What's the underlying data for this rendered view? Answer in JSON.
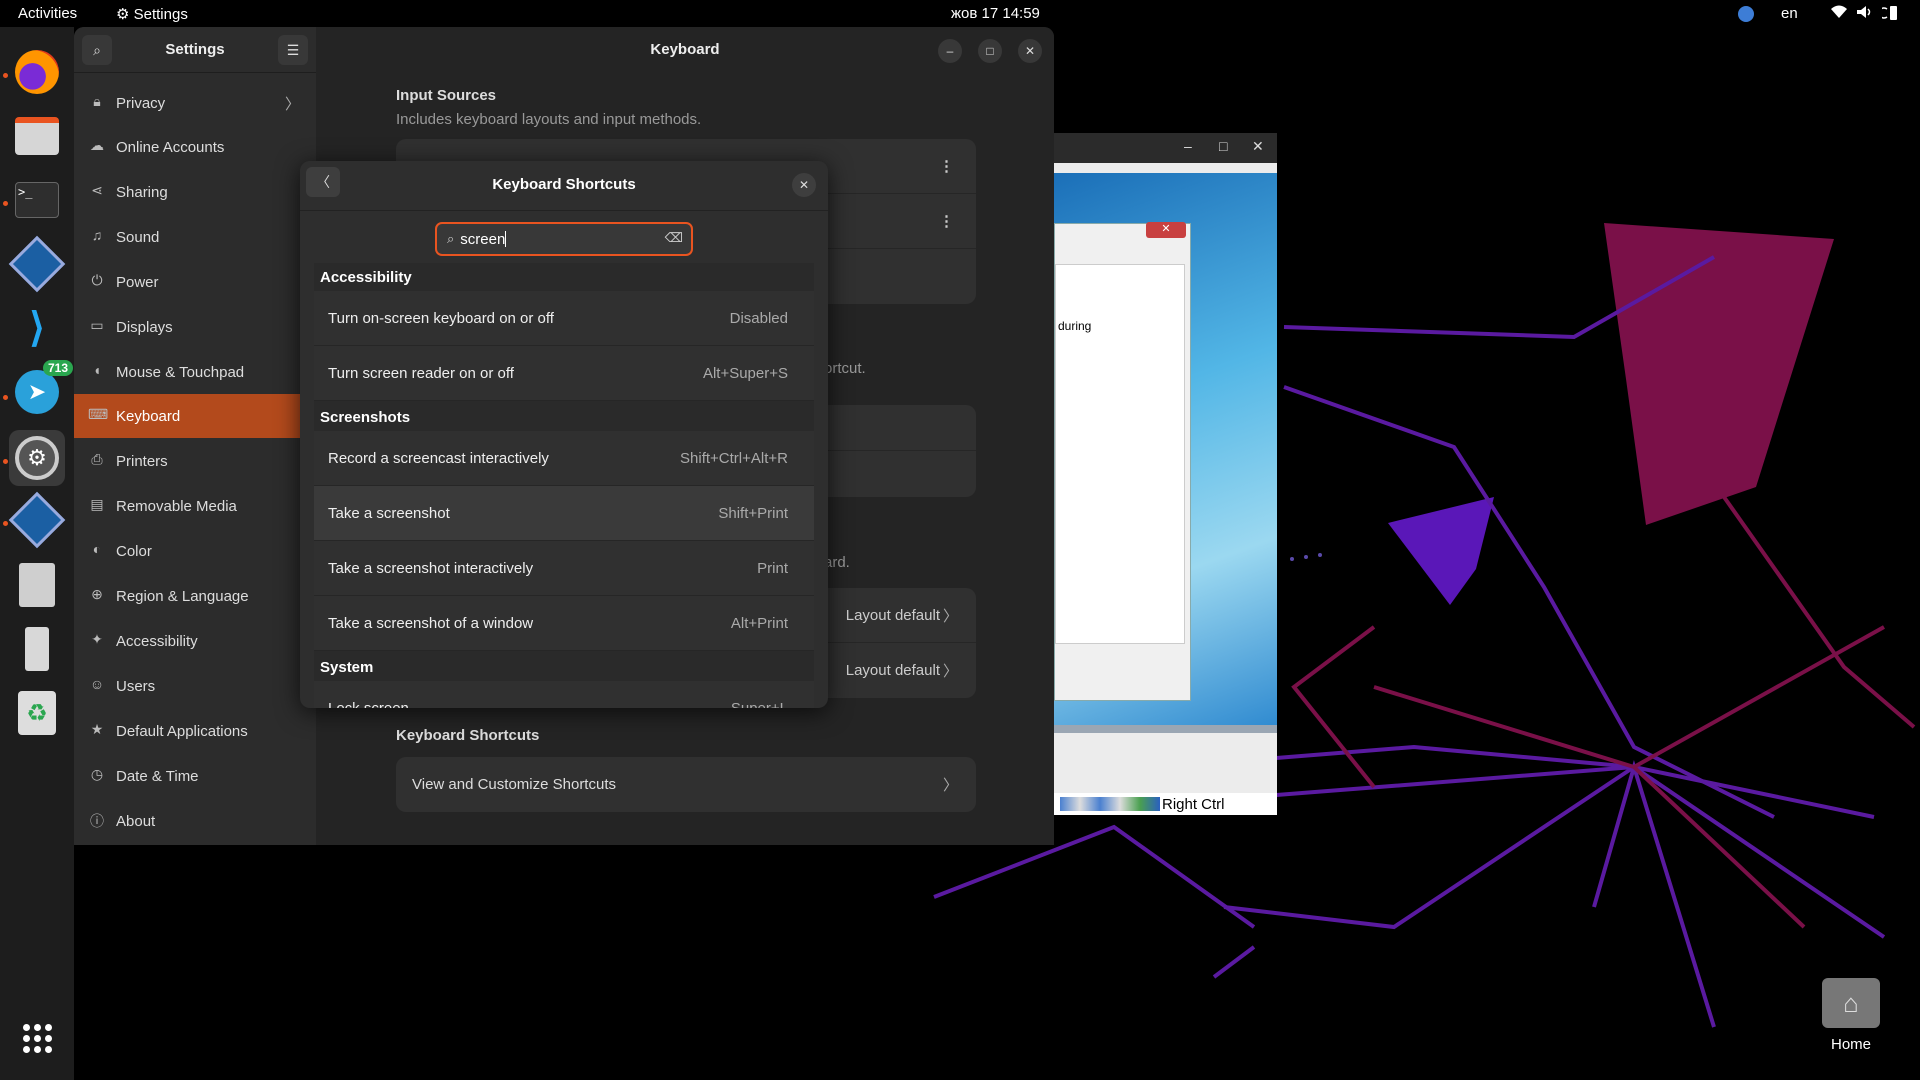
{
  "topbar": {
    "activities": "Activities",
    "app_name": "Settings",
    "datetime": "жов 17  14:59",
    "language": "en"
  },
  "dock": {
    "items": [
      {
        "icon": "firefox-icon"
      },
      {
        "icon": "files-icon"
      },
      {
        "icon": "terminal-icon"
      },
      {
        "icon": "virtualbox-icon"
      },
      {
        "icon": "vscode-icon"
      },
      {
        "icon": "telegram-icon",
        "badge": "713"
      },
      {
        "icon": "settings-icon"
      },
      {
        "icon": "virtualbox-icon"
      },
      {
        "icon": "text-editor-icon"
      },
      {
        "icon": "usb-drive-icon"
      },
      {
        "icon": "trash-icon"
      },
      {
        "icon": "app-grid-icon"
      }
    ]
  },
  "settings_window": {
    "sidebar_title": "Settings",
    "main_title": "Keyboard",
    "sidebar_items": [
      {
        "label": "Privacy",
        "icon": "lock-icon"
      },
      {
        "label": "Online Accounts",
        "icon": "cloud-icon"
      },
      {
        "label": "Sharing",
        "icon": "share-icon"
      },
      {
        "label": "Sound",
        "icon": "music-note-icon"
      },
      {
        "label": "Power",
        "icon": "power-icon"
      },
      {
        "label": "Displays",
        "icon": "display-icon"
      },
      {
        "label": "Mouse & Touchpad",
        "icon": "mouse-icon"
      },
      {
        "label": "Keyboard",
        "icon": "keyboard-icon"
      },
      {
        "label": "Printers",
        "icon": "printer-icon"
      },
      {
        "label": "Removable Media",
        "icon": "media-icon"
      },
      {
        "label": "Color",
        "icon": "color-icon"
      },
      {
        "label": "Region & Language",
        "icon": "globe-icon"
      },
      {
        "label": "Accessibility",
        "icon": "accessibility-icon"
      },
      {
        "label": "Users",
        "icon": "users-icon"
      },
      {
        "label": "Default Applications",
        "icon": "star-icon"
      },
      {
        "label": "Date & Time",
        "icon": "clock-icon"
      },
      {
        "label": "About",
        "icon": "info-icon"
      }
    ],
    "input_sources": {
      "title": "Input Sources",
      "subtitle": "Includes keyboard layouts and input methods."
    },
    "partial_texts": {
      "shortcut_suffix": "ortcut.",
      "keyboard_suffix": "ard."
    },
    "layout_rows": [
      {
        "value": "Layout default"
      },
      {
        "value": "Layout default"
      }
    ],
    "keyboard_shortcuts": {
      "title": "Keyboard Shortcuts",
      "row_label": "View and Customize Shortcuts"
    }
  },
  "dialog": {
    "title": "Keyboard Shortcuts",
    "search_value": "screen",
    "groups": [
      {
        "name": "Accessibility",
        "rows": [
          {
            "label": "Turn on-screen keyboard on or off",
            "accel": "Disabled"
          },
          {
            "label": "Turn screen reader on or off",
            "accel": "Alt+Super+S"
          }
        ]
      },
      {
        "name": "Screenshots",
        "rows": [
          {
            "label": "Record a screencast interactively",
            "accel": "Shift+Ctrl+Alt+R"
          },
          {
            "label": "Take a screenshot",
            "accel": "Shift+Print"
          },
          {
            "label": "Take a screenshot interactively",
            "accel": "Print"
          },
          {
            "label": "Take a screenshot of a window",
            "accel": "Alt+Print"
          }
        ]
      },
      {
        "name": "System",
        "rows": [
          {
            "label": "Lock screen",
            "accel": "Super+L"
          }
        ]
      }
    ]
  },
  "vbox": {
    "dialog_text": "during",
    "status_text": "Right Ctrl"
  },
  "desktop": {
    "home_label": "Home"
  },
  "colors": {
    "accent": "#e95420",
    "selected_sidebar": "#b34a1c",
    "window_bg": "#242424"
  }
}
